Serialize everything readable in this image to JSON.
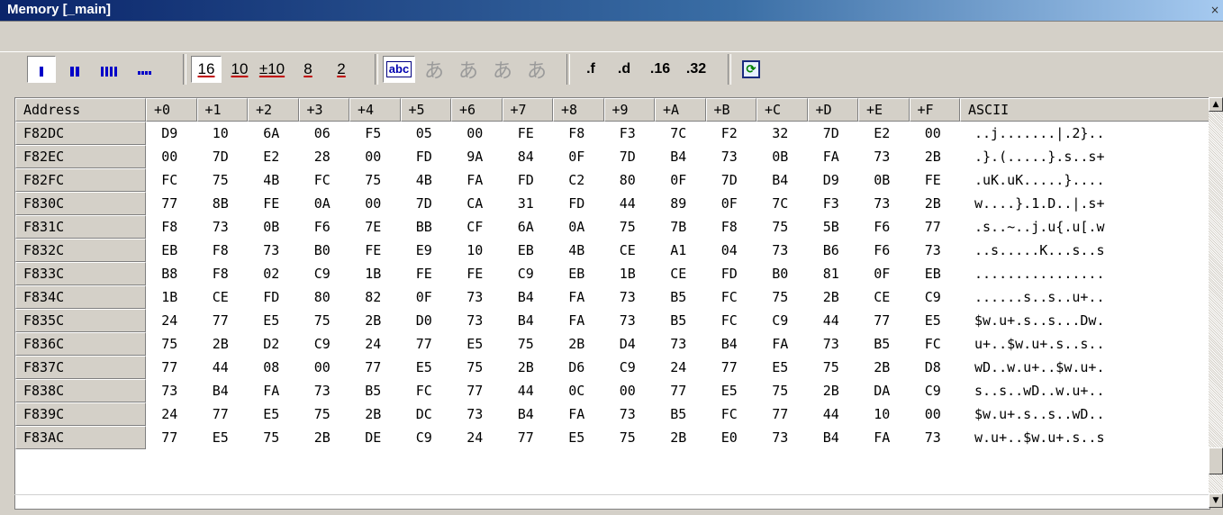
{
  "window": {
    "title": "Memory [_main]",
    "close_glyph": "×"
  },
  "toolbar": {
    "groups": [
      {
        "name": "width-1",
        "pressed": true
      },
      {
        "name": "width-2",
        "pressed": false
      },
      {
        "name": "width-4",
        "pressed": false
      },
      {
        "name": "width-8",
        "pressed": false
      }
    ],
    "radix": [
      "16",
      "10",
      "±10",
      "8",
      "2"
    ],
    "text": [
      "abc",
      "あ",
      "あ",
      "あ",
      "あ"
    ],
    "float": [
      ".f",
      ".d",
      ".16",
      ".32"
    ],
    "refresh_icon": "refresh-icon"
  },
  "grid": {
    "headers": [
      "Address",
      "+0",
      "+1",
      "+2",
      "+3",
      "+4",
      "+5",
      "+6",
      "+7",
      "+8",
      "+9",
      "+A",
      "+B",
      "+C",
      "+D",
      "+E",
      "+F",
      "ASCII"
    ],
    "rows": [
      {
        "address": "F82DC",
        "bytes": [
          "D9",
          "10",
          "6A",
          "06",
          "F5",
          "05",
          "00",
          "FE",
          "F8",
          "F3",
          "7C",
          "F2",
          "32",
          "7D",
          "E2",
          "00"
        ],
        "ascii": "..j.......|.2}.."
      },
      {
        "address": "F82EC",
        "bytes": [
          "00",
          "7D",
          "E2",
          "28",
          "00",
          "FD",
          "9A",
          "84",
          "0F",
          "7D",
          "B4",
          "73",
          "0B",
          "FA",
          "73",
          "2B"
        ],
        "ascii": ".}.(.....}.s..s+"
      },
      {
        "address": "F82FC",
        "bytes": [
          "FC",
          "75",
          "4B",
          "FC",
          "75",
          "4B",
          "FA",
          "FD",
          "C2",
          "80",
          "0F",
          "7D",
          "B4",
          "D9",
          "0B",
          "FE"
        ],
        "ascii": ".uK.uK.....}...."
      },
      {
        "address": "F830C",
        "bytes": [
          "77",
          "8B",
          "FE",
          "0A",
          "00",
          "7D",
          "CA",
          "31",
          "FD",
          "44",
          "89",
          "0F",
          "7C",
          "F3",
          "73",
          "2B"
        ],
        "ascii": "w....}.1.D..|.s+"
      },
      {
        "address": "F831C",
        "bytes": [
          "F8",
          "73",
          "0B",
          "F6",
          "7E",
          "BB",
          "CF",
          "6A",
          "0A",
          "75",
          "7B",
          "F8",
          "75",
          "5B",
          "F6",
          "77"
        ],
        "ascii": ".s..~..j.u{.u[.w"
      },
      {
        "address": "F832C",
        "bytes": [
          "EB",
          "F8",
          "73",
          "B0",
          "FE",
          "E9",
          "10",
          "EB",
          "4B",
          "CE",
          "A1",
          "04",
          "73",
          "B6",
          "F6",
          "73"
        ],
        "ascii": "..s.....K...s..s"
      },
      {
        "address": "F833C",
        "bytes": [
          "B8",
          "F8",
          "02",
          "C9",
          "1B",
          "FE",
          "FE",
          "C9",
          "EB",
          "1B",
          "CE",
          "FD",
          "B0",
          "81",
          "0F",
          "EB"
        ],
        "ascii": "................"
      },
      {
        "address": "F834C",
        "bytes": [
          "1B",
          "CE",
          "FD",
          "80",
          "82",
          "0F",
          "73",
          "B4",
          "FA",
          "73",
          "B5",
          "FC",
          "75",
          "2B",
          "CE",
          "C9"
        ],
        "ascii": "......s..s..u+.."
      },
      {
        "address": "F835C",
        "bytes": [
          "24",
          "77",
          "E5",
          "75",
          "2B",
          "D0",
          "73",
          "B4",
          "FA",
          "73",
          "B5",
          "FC",
          "C9",
          "44",
          "77",
          "E5"
        ],
        "ascii": "$w.u+.s..s...Dw."
      },
      {
        "address": "F836C",
        "bytes": [
          "75",
          "2B",
          "D2",
          "C9",
          "24",
          "77",
          "E5",
          "75",
          "2B",
          "D4",
          "73",
          "B4",
          "FA",
          "73",
          "B5",
          "FC"
        ],
        "ascii": "u+..$w.u+.s..s.."
      },
      {
        "address": "F837C",
        "bytes": [
          "77",
          "44",
          "08",
          "00",
          "77",
          "E5",
          "75",
          "2B",
          "D6",
          "C9",
          "24",
          "77",
          "E5",
          "75",
          "2B",
          "D8"
        ],
        "ascii": "wD..w.u+..$w.u+."
      },
      {
        "address": "F838C",
        "bytes": [
          "73",
          "B4",
          "FA",
          "73",
          "B5",
          "FC",
          "77",
          "44",
          "0C",
          "00",
          "77",
          "E5",
          "75",
          "2B",
          "DA",
          "C9"
        ],
        "ascii": "s..s..wD..w.u+.."
      },
      {
        "address": "F839C",
        "bytes": [
          "24",
          "77",
          "E5",
          "75",
          "2B",
          "DC",
          "73",
          "B4",
          "FA",
          "73",
          "B5",
          "FC",
          "77",
          "44",
          "10",
          "00"
        ],
        "ascii": "$w.u+.s..s..wD.."
      },
      {
        "address": "F83AC",
        "bytes": [
          "77",
          "E5",
          "75",
          "2B",
          "DE",
          "C9",
          "24",
          "77",
          "E5",
          "75",
          "2B",
          "E0",
          "73",
          "B4",
          "FA",
          "73"
        ],
        "ascii": "w.u+..$w.u+.s..s"
      }
    ]
  },
  "scrollbar": {
    "up_glyph": "▲",
    "down_glyph": "▼"
  }
}
